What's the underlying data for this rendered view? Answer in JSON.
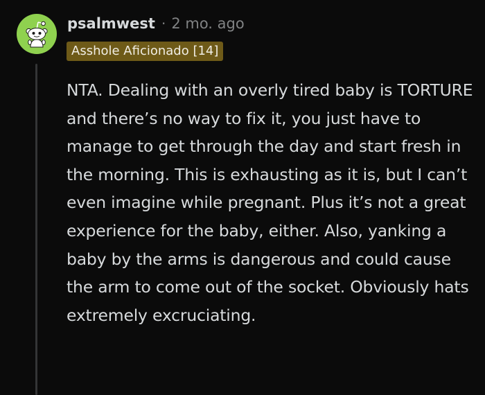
{
  "comment": {
    "username": "psalmwest",
    "separator": "·",
    "timestamp": "2 mo. ago",
    "flair": "Asshole Aficionado [14]",
    "body": "NTA. Dealing with an overly tired baby is TORTURE and there’s no way to fix it, you just have to manage to get through the day and start fresh in the morning. This is exhausting as it is, but I can’t even imagine while pregnant. Plus it’s not a great experience for the baby, either. Also, yanking a baby by the arms is dangerous and could cause the arm to come out of the socket. Obviously hats extremely excruciating.",
    "avatar_icon": "snoo-avatar-icon"
  },
  "colors": {
    "background": "#0b0b0b",
    "avatar_bg": "#8fd14f",
    "flair_bg": "#6e5a18",
    "text": "#d7dadc",
    "meta": "#818384",
    "thread_line": "#343536"
  }
}
